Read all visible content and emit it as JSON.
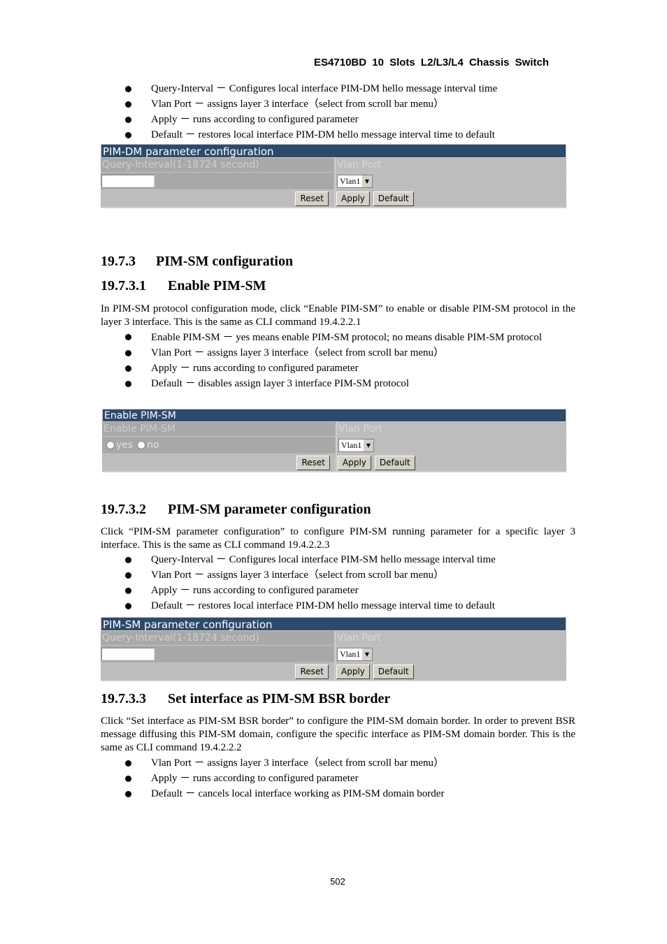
{
  "header": {
    "title": "ES4710BD  10  Slots  L2/L3/L4  Chassis  Switch"
  },
  "intro_bullets": [
    "Query-Interval  －  Configures local interface PIM-DM hello message interval time",
    "Vlan Port  －  assigns layer 3 interface（select from scroll bar menu）",
    "Apply  －  runs according to configured parameter",
    "Default  －  restores local interface PIM-DM hello message interval time to default"
  ],
  "panel_pimdm": {
    "title": "PIM-DM parameter configuration",
    "col1_header": "Query-Interval(1-18724 second)",
    "col2_header": "Vlan Port",
    "query_interval_value": "",
    "vlan_selected": "Vlan1",
    "reset_label": "Reset",
    "apply_label": "Apply",
    "default_label": "Default"
  },
  "section_1973": {
    "number": "19.7.3",
    "title": "PIM-SM configuration"
  },
  "section_19731": {
    "number": "19.7.3.1",
    "title": "Enable PIM-SM",
    "paragraph": "In PIM-SM protocol configuration mode, click “Enable PIM-SM” to enable or disable PIM-SM protocol in the layer 3 interface. This is the same as CLI command 19.4.2.2.1",
    "bullets": [
      "Enable PIM-SM  －  yes means enable PIM-SM protocol; no means disable PIM-SM protocol",
      "Vlan Port  －  assigns layer 3 interface（select from scroll bar menu）",
      "Apply  －  runs according to configured parameter",
      "Default  －  disables assign layer 3 interface PIM-SM protocol"
    ]
  },
  "panel_enable": {
    "title": "Enable PIM-SM",
    "col1_header": "Enable PIM-SM",
    "col2_header": "Vlan Port",
    "radio_yes": "yes",
    "radio_no": "no",
    "vlan_selected": "Vlan1",
    "reset_label": "Reset",
    "apply_label": "Apply",
    "default_label": "Default"
  },
  "section_19732": {
    "number": "19.7.3.2",
    "title": "PIM-SM parameter configuration",
    "paragraph": "Click “PIM-SM parameter configuration” to configure PIM-SM running parameter for a specific layer 3 interface. This is the same as CLI command 19.4.2.2.3",
    "bullets": [
      "Query-Interval  －  Configures local interface PIM-SM hello message interval time",
      "Vlan Port  －  assigns layer 3 interface（select from scroll bar menu）",
      "Apply  －  runs according to configured parameter",
      "Default  －  restores local interface PIM-DM hello message interval time to default"
    ]
  },
  "panel_pimsm": {
    "title": "PIM-SM parameter configuration",
    "col1_header": "Query-Interval(1-18724 second)",
    "col2_header": "Vlan Port",
    "query_interval_value": "",
    "vlan_selected": "Vlan1",
    "reset_label": "Reset",
    "apply_label": "Apply",
    "default_label": "Default"
  },
  "section_19733": {
    "number": "19.7.3.3",
    "title": "Set interface as PIM-SM BSR border",
    "paragraph": "Click “Set interface as PIM-SM BSR border” to configure the PIM-SM domain border. In order to prevent BSR message diffusing this PIM-SM domain, configure the specific interface as PIM-SM domain border. This is the same as CLI command 19.4.2.2.2",
    "bullets": [
      "Vlan Port  －  assigns layer 3 interface（select from scroll bar menu）",
      "Apply  －  runs according to configured parameter",
      "Default  －  cancels local interface working as PIM-SM domain border"
    ]
  },
  "footer": {
    "page_number": "502"
  }
}
